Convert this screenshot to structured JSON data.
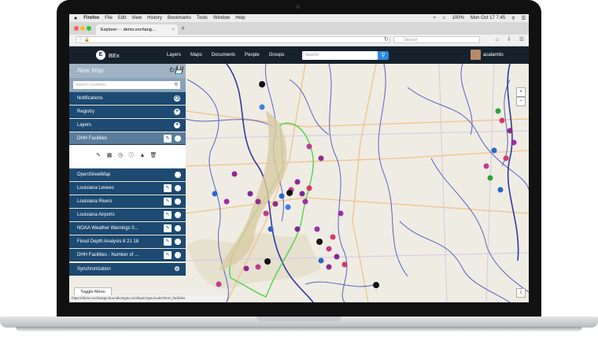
{
  "macmenu": {
    "apple": "",
    "app": "Firefox",
    "items": [
      "File",
      "Edit",
      "View",
      "History",
      "Bookmarks",
      "Tools",
      "Window",
      "Help"
    ],
    "battery": "100%",
    "clock": "Mon Oct 17 7:45"
  },
  "browser": {
    "tab_title": "Explorer - - demo.exchang...",
    "tab_close": "×",
    "new_tab": "+",
    "search_placeholder": "Search"
  },
  "app": {
    "brand": "BEx",
    "logo_letter": "E",
    "nav": [
      "Layers",
      "Maps",
      "Documents",
      "People",
      "Groups"
    ],
    "search_placeholder": "Search",
    "username": "acalamito"
  },
  "sidebar": {
    "title": "New Map",
    "search_placeholder": "Search Locations",
    "sections": {
      "notifications": "Notifications",
      "registry": "Registry",
      "layers": "Layers"
    },
    "selected_layer": "DHH Facilities",
    "layers": [
      "OpenStreetMap",
      "Louisiana Levees",
      "Louisiana Rivers",
      "Louisiana Airports",
      "NOAA Weather Warnings 0...",
      "Flood Depth Analysis 8 21 18",
      "DHH Facilities - Number of ..."
    ],
    "synchronization": "Synchronization",
    "toggle_menu": "Toggle Menu"
  },
  "status_url": "https://demo.exchange.boundlessgis.com/layers/geonode:DHH_facilities",
  "colors": {
    "header_bg": "#16212c",
    "sidebar_row": "#1d4a72",
    "sidebar_selected": "#5a7d9c",
    "accent_blue": "#2b8be0",
    "river": "#5563c4",
    "levee": "#4fd34a"
  }
}
